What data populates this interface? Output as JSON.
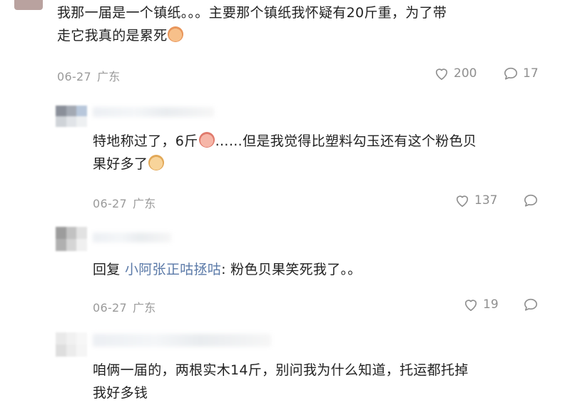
{
  "comments": [
    {
      "text": "我那一届是一个镇纸。。。主要那个镇纸我怀疑有20斤重，为了带",
      "text_line2": "走它我真的是累死",
      "emoji": "tired-face-emoji",
      "date": "06-27",
      "location": "广东",
      "likes": "200",
      "replies": "17"
    },
    {
      "text": "特地称过了，6斤",
      "text_after_emoji": "……但是我觉得比塑料勾玉还有这个粉色贝",
      "text_line2": "果好多了",
      "emoji1": "crying-face-emoji",
      "emoji2": "happy-face-emoji",
      "date": "06-27",
      "location": "广东",
      "likes": "137"
    },
    {
      "reply_prefix": "回复",
      "reply_to": "小阿张正咕拯咕",
      "text": ": 粉色贝果笑死我了。。",
      "date": "06-27",
      "location": "广东",
      "likes": "19"
    },
    {
      "text": "咱俩一届的，两根实木14斤，别问我为什么知道，托运都托掉",
      "text_line2": "我好多钱"
    }
  ],
  "icons": {
    "like": "heart-outline-icon",
    "reply": "speech-bubble-icon"
  },
  "colors": {
    "text": "#222222",
    "meta": "#9a9a9a",
    "link": "#5b7aa8",
    "background": "#ffffff"
  }
}
